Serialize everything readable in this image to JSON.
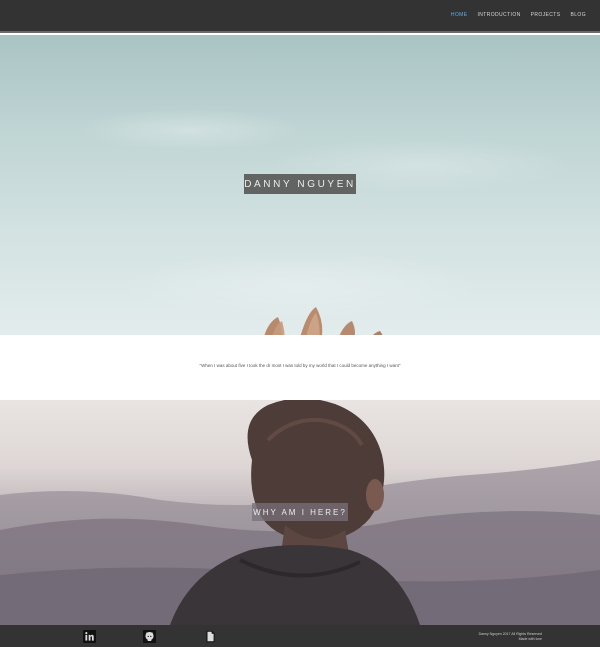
{
  "nav": {
    "items": [
      {
        "label": "Home",
        "active": true
      },
      {
        "label": "Introduction",
        "active": false
      },
      {
        "label": "Projects",
        "active": false
      },
      {
        "label": "Blog",
        "active": false
      }
    ]
  },
  "hero": {
    "name": "Danny Nguyen"
  },
  "quote": {
    "text": "\"When I was about five I took the dr most I was told by my world that I could become anything I want\""
  },
  "section2": {
    "heading": "Why am I here?"
  },
  "footer": {
    "icons": [
      "linkedin-icon",
      "github-icon",
      "document-icon"
    ],
    "copyright_line1": "Danny Nguyen 2017 All Rights Reserved",
    "copyright_line2": "Made with love"
  },
  "colors": {
    "navbar": "#333333",
    "nav_active": "#5fb0e6",
    "footer": "#333333"
  }
}
